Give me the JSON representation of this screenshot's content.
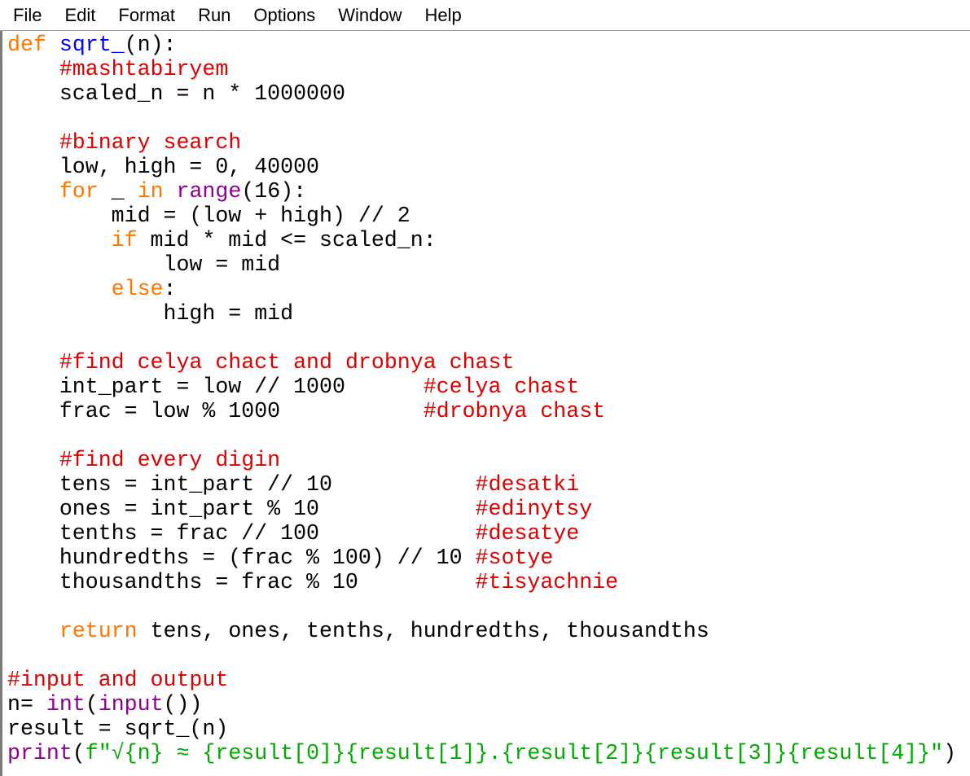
{
  "menu": [
    "File",
    "Edit",
    "Format",
    "Run",
    "Options",
    "Window",
    "Help"
  ],
  "code_lines": [
    [
      {
        "t": "def",
        "c": "kw"
      },
      {
        "t": " "
      },
      {
        "t": "sqrt_",
        "c": "def"
      },
      {
        "t": "(n):"
      }
    ],
    [
      {
        "t": "    "
      },
      {
        "t": "#mashtabiryem",
        "c": "cm"
      }
    ],
    [
      {
        "t": "    scaled_n = n * 1000000"
      }
    ],
    [],
    [
      {
        "t": "    "
      },
      {
        "t": "#binary search",
        "c": "cm"
      }
    ],
    [
      {
        "t": "    low, high = 0, 40000"
      }
    ],
    [
      {
        "t": "    "
      },
      {
        "t": "for",
        "c": "kw"
      },
      {
        "t": " _ "
      },
      {
        "t": "in",
        "c": "kw"
      },
      {
        "t": " "
      },
      {
        "t": "range",
        "c": "bi"
      },
      {
        "t": "(16):"
      }
    ],
    [
      {
        "t": "        mid = (low + high) // 2"
      }
    ],
    [
      {
        "t": "        "
      },
      {
        "t": "if",
        "c": "kw"
      },
      {
        "t": " mid * mid <= scaled_n:"
      }
    ],
    [
      {
        "t": "            low = mid"
      }
    ],
    [
      {
        "t": "        "
      },
      {
        "t": "else",
        "c": "kw"
      },
      {
        "t": ":"
      }
    ],
    [
      {
        "t": "            high = mid"
      }
    ],
    [],
    [
      {
        "t": "    "
      },
      {
        "t": "#find celya chact and drobnya chast",
        "c": "cm"
      }
    ],
    [
      {
        "t": "    int_part = low // 1000      "
      },
      {
        "t": "#celya chast",
        "c": "cm"
      }
    ],
    [
      {
        "t": "    frac = low % 1000           "
      },
      {
        "t": "#drobnya chast",
        "c": "cm"
      }
    ],
    [],
    [
      {
        "t": "    "
      },
      {
        "t": "#find every digin",
        "c": "cm"
      }
    ],
    [
      {
        "t": "    tens = int_part // 10           "
      },
      {
        "t": "#desatki",
        "c": "cm"
      }
    ],
    [
      {
        "t": "    ones = int_part % 10            "
      },
      {
        "t": "#edinytsy",
        "c": "cm"
      }
    ],
    [
      {
        "t": "    tenths = frac // 100            "
      },
      {
        "t": "#desatye",
        "c": "cm"
      }
    ],
    [
      {
        "t": "    hundredths = (frac % 100) // 10 "
      },
      {
        "t": "#sotye",
        "c": "cm"
      }
    ],
    [
      {
        "t": "    thousandths = frac % 10         "
      },
      {
        "t": "#tisyachnie",
        "c": "cm"
      }
    ],
    [],
    [
      {
        "t": "    "
      },
      {
        "t": "return",
        "c": "kw"
      },
      {
        "t": " tens, ones, tenths, hundredths, thousandths"
      }
    ],
    [],
    [
      {
        "t": "#input and output",
        "c": "cm"
      }
    ],
    [
      {
        "t": "n= "
      },
      {
        "t": "int",
        "c": "bi"
      },
      {
        "t": "("
      },
      {
        "t": "input",
        "c": "bi"
      },
      {
        "t": "())"
      }
    ],
    [
      {
        "t": "result = sqrt_(n)"
      }
    ],
    [
      {
        "t": "print",
        "c": "bi"
      },
      {
        "t": "("
      },
      {
        "t": "f\"√{n} ≈ {result[0]}{result[1]}.{result[2]}{result[3]}{result[4]}\"",
        "c": "st"
      },
      {
        "t": ")"
      }
    ]
  ]
}
